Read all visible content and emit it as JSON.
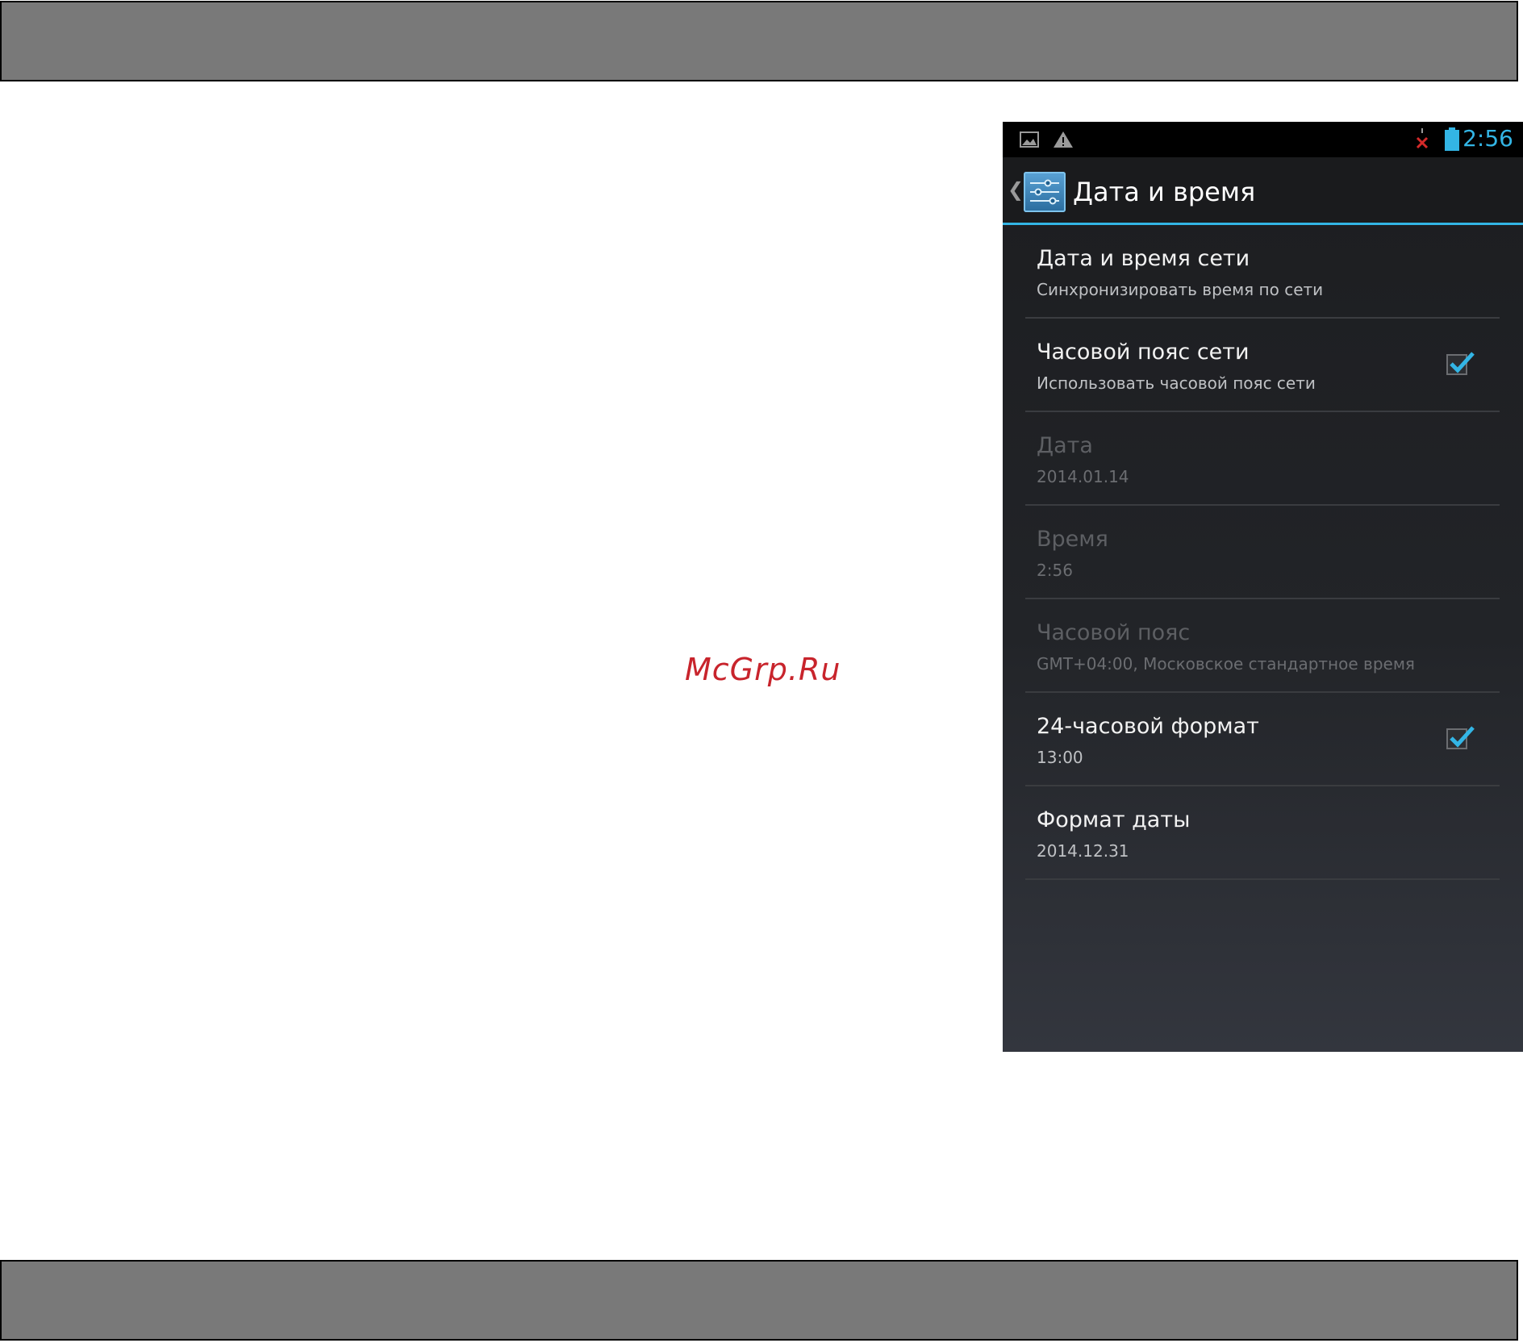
{
  "watermark": "McGrp.Ru",
  "status_bar": {
    "time": "2:56",
    "icons": [
      "image-icon",
      "warning-icon",
      "no-signal-icon",
      "battery-icon"
    ]
  },
  "action_bar": {
    "title": "Дата и время",
    "icon": "settings-sliders-icon"
  },
  "preferences": [
    {
      "title": "Дата и время сети",
      "summary": "Синхронизировать время по сети",
      "enabled": true,
      "checkbox": null
    },
    {
      "title": "Часовой пояс сети",
      "summary": "Использовать часовой пояс сети",
      "enabled": true,
      "checkbox": true
    },
    {
      "title": "Дата",
      "summary": "2014.01.14",
      "enabled": false,
      "checkbox": null
    },
    {
      "title": "Время",
      "summary": "2:56",
      "enabled": false,
      "checkbox": null
    },
    {
      "title": "Часовой пояс",
      "summary": "GMT+04:00, Московское стандартное время",
      "enabled": false,
      "checkbox": null
    },
    {
      "title": "24-часовой формат",
      "summary": "13:00",
      "enabled": true,
      "checkbox": true
    },
    {
      "title": "Формат даты",
      "summary": "2014.12.31",
      "enabled": true,
      "checkbox": null
    }
  ],
  "colors": {
    "accent": "#33b5e5",
    "watermark": "#c8242c",
    "page_band": "#797979"
  }
}
